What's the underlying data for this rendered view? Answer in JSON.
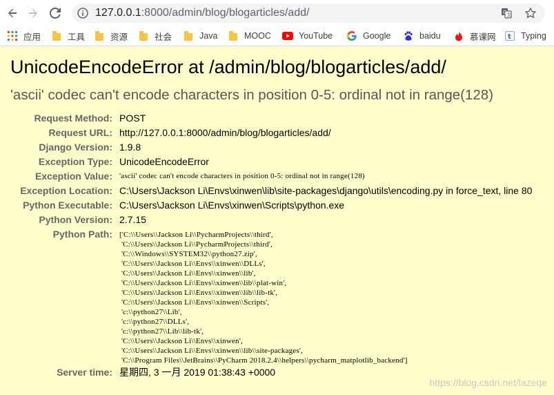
{
  "browser": {
    "url_host": "127.0.0.1",
    "url_rest": ":8000/admin/blog/blogarticles/add/",
    "bookmarks": [
      {
        "label": "应用",
        "icon": "apps-grid-icon"
      },
      {
        "label": "工具",
        "icon": "folder-icon"
      },
      {
        "label": "资源",
        "icon": "folder-icon"
      },
      {
        "label": "社会",
        "icon": "folder-icon"
      },
      {
        "label": "Java",
        "icon": "folder-icon"
      },
      {
        "label": "MOOC",
        "icon": "folder-icon"
      },
      {
        "label": "YouTube",
        "icon": "youtube-icon"
      },
      {
        "label": "Google",
        "icon": "google-icon"
      },
      {
        "label": "baidu",
        "icon": "baidu-paw-icon"
      },
      {
        "label": "慕课网",
        "icon": "imooc-flame-icon"
      },
      {
        "label": "Typing",
        "icon": "typing-icon"
      }
    ]
  },
  "error": {
    "title": "UnicodeEncodeError at /admin/blog/blogarticles/add/",
    "subtitle": "'ascii' codec can't encode characters in position 0-5: ordinal not in range(128)",
    "rows": [
      {
        "label": "Request Method:",
        "value": "POST"
      },
      {
        "label": "Request URL:",
        "value": "http://127.0.0.1:8000/admin/blog/blogarticles/add/"
      },
      {
        "label": "Django Version:",
        "value": "1.9.8"
      },
      {
        "label": "Exception Type:",
        "value": "UnicodeEncodeError"
      },
      {
        "label": "Exception Value:",
        "value": "'ascii' codec can't encode characters in position 0-5: ordinal not in range(128)"
      },
      {
        "label": "Exception Location:",
        "value": "C:\\Users\\Jackson Li\\Envs\\xinwen\\lib\\site-packages\\django\\utils\\encoding.py in force_text, line 80"
      },
      {
        "label": "Python Executable:",
        "value": "C:\\Users\\Jackson Li\\Envs\\xinwen\\Scripts\\python.exe"
      },
      {
        "label": "Python Version:",
        "value": "2.7.15"
      },
      {
        "label": "Python Path:",
        "value": "['C:\\\\Users\\\\Jackson Li\\\\PycharmProjects\\\\third',\n 'C:\\\\Users\\\\Jackson Li\\\\PycharmProjects\\\\third',\n 'C:\\\\Windows\\\\SYSTEM32\\\\python27.zip',\n 'C:\\\\Users\\\\Jackson Li\\\\Envs\\\\xinwen\\\\DLLs',\n 'C:\\\\Users\\\\Jackson Li\\\\Envs\\\\xinwen\\\\lib',\n 'C:\\\\Users\\\\Jackson Li\\\\Envs\\\\xinwen\\\\lib\\\\plat-win',\n 'C:\\\\Users\\\\Jackson Li\\\\Envs\\\\xinwen\\\\lib\\\\lib-tk',\n 'C:\\\\Users\\\\Jackson Li\\\\Envs\\\\xinwen\\\\Scripts',\n 'c:\\\\python27\\\\Lib',\n 'c:\\\\python27\\\\DLLs',\n 'c:\\\\python27\\\\Lib\\\\lib-tk',\n 'C:\\\\Users\\\\Jackson Li\\\\Envs\\\\xinwen',\n 'C:\\\\Users\\\\Jackson Li\\\\Envs\\\\xinwen\\\\lib\\\\site-packages',\n 'C:\\\\Program Files\\\\JetBrains\\\\PyCharm 2018.2.4\\\\helpers\\\\pycharm_matplotlib_backend']"
      },
      {
        "label": "Server time:",
        "value": "星期四, 3 一月 2019 01:38:43 +0000"
      }
    ]
  },
  "watermark": "https://blog.csdn.net/lazeqe"
}
